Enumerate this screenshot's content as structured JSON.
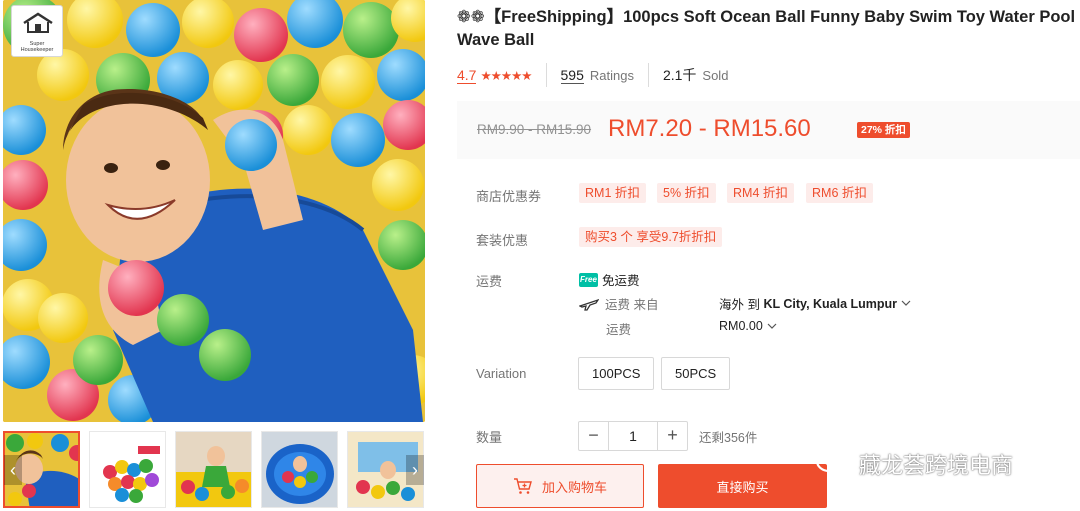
{
  "brand": {
    "line1": "Super",
    "line2": "Housekeeper"
  },
  "product": {
    "title": "❁❁【FreeShipping】100pcs Soft Ocean Ball Funny Baby Swim Toy Water Pool Wave Ball",
    "rating": "4.7",
    "stars": "★★★★★",
    "ratings_count": "595",
    "ratings_label": "Ratings",
    "sold_count": "2.1千",
    "sold_label": "Sold"
  },
  "price": {
    "original": "RM9.90 - RM15.90",
    "sale": "RM7.20 - RM15.60",
    "discount": "27% 折扣"
  },
  "vouchers": {
    "label": "商店优惠券",
    "items": [
      "RM1 折扣",
      "5% 折扣",
      "RM4 折扣",
      "RM6 折扣"
    ]
  },
  "bundle": {
    "label": "套装优惠",
    "text": "购买3 个 享受9.7折折扣"
  },
  "shipping": {
    "label": "运费",
    "free_badge": "Free",
    "free_text": "免运费",
    "from_label": "运费 来自",
    "origin": "海外 到",
    "destination": "KL City, Kuala Lumpur",
    "fee_label": "运费",
    "fee": "RM0.00"
  },
  "variation": {
    "label": "Variation",
    "options": [
      "100PCS",
      "50PCS"
    ]
  },
  "quantity": {
    "label": "数量",
    "minus": "−",
    "value": "1",
    "plus": "+",
    "stock": "还剩356件"
  },
  "actions": {
    "add_to_cart": "加入购物车",
    "buy_now": "直接购买"
  },
  "watermark": {
    "text": "藏龙荟跨境电商"
  },
  "colors": {
    "accent": "#ee4d2d",
    "accent_bg": "#fdecea",
    "free_shipping": "#00bfa5"
  }
}
